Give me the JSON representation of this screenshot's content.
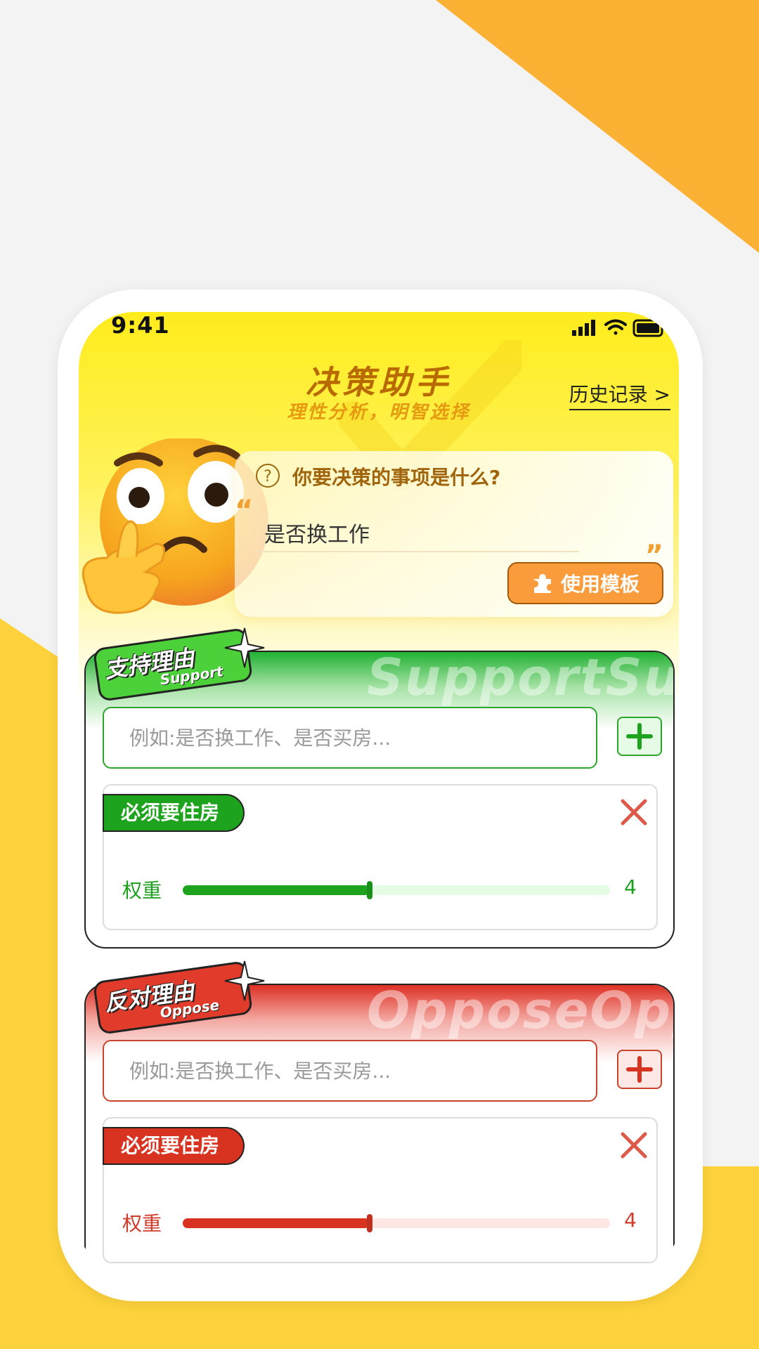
{
  "status": {
    "time": "9:41"
  },
  "header": {
    "title": "决策助手",
    "subtitle": "理性分析，明智选择",
    "history_link": "历史记录 >"
  },
  "question": {
    "label": "你要决策的事项是什么?",
    "value": "是否换工作",
    "template_button": "使用模板"
  },
  "support": {
    "badge_title": "支持理由",
    "badge_sub": "Support",
    "watermark": "SupportSupport",
    "input_placeholder": "例如:是否换工作、是否买房...",
    "items": [
      {
        "tag": "必须要住房",
        "weight_label": "权重",
        "weight": "4",
        "weight_fraction": 0.44
      }
    ]
  },
  "oppose": {
    "badge_title": "反对理由",
    "badge_sub": "Oppose",
    "watermark": "OpposeOppose",
    "input_placeholder": "例如:是否换工作、是否买房...",
    "items": [
      {
        "tag": "必须要住房",
        "weight_label": "权重",
        "weight": "4",
        "weight_fraction": 0.44
      }
    ]
  },
  "colors": {
    "support": "#1da31d",
    "oppose": "#d83320",
    "accent": "#fb9c3c"
  },
  "icons": [
    "question-icon",
    "puzzle-icon",
    "plus-icon",
    "close-icon",
    "signal-icon",
    "wifi-icon",
    "battery-icon",
    "sparkle-icon"
  ]
}
